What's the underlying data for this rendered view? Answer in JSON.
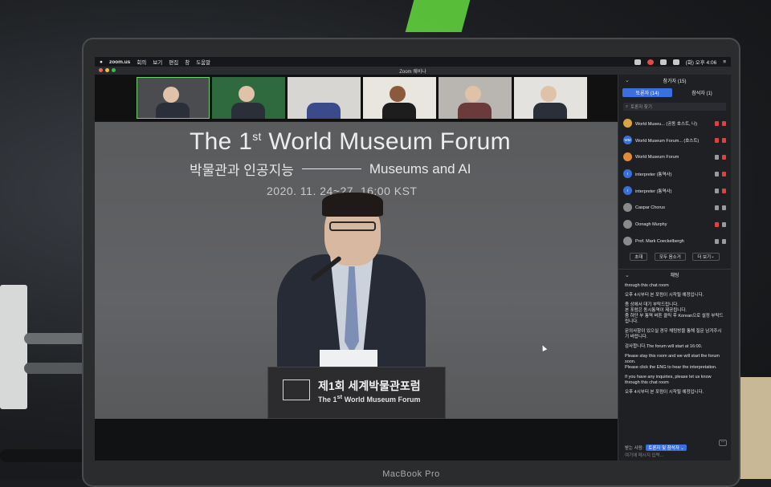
{
  "menubar": {
    "app": "zoom.us",
    "items": [
      "회의",
      "보기",
      "편집",
      "창",
      "도움말"
    ],
    "clock": "(화) 오후 4:06"
  },
  "window": {
    "title": "Zoom 웨비나"
  },
  "main_video": {
    "title": "The 1",
    "title_sup": "st",
    "title_rest": " World Museum Forum",
    "subtitle_kr": "박물관과 인공지능",
    "subtitle_en": "Museums and AI",
    "date": "2020. 11. 24~27. 16:00 KST",
    "podium_kr": "제1회 세계박물관포럼",
    "podium_en_a": "The 1",
    "podium_en_sup": "st",
    "podium_en_b": " World Museum Forum"
  },
  "panel": {
    "title": "참가자 (15)",
    "tab_panelists": "토론자 (14)",
    "tab_attendees": "참석자 (1)",
    "search_placeholder": "토론자 찾기",
    "participants": [
      {
        "name": "World Museu... (공동 호스트, 나)",
        "initials": "",
        "color": "#d9a441"
      },
      {
        "name": "World Museum Forum... (호스트)",
        "initials": "WM",
        "color": "#3a6fd6"
      },
      {
        "name": "World Museum Forum",
        "initials": "",
        "color": "#e08a3a"
      },
      {
        "name": "interpreter (통역사)",
        "initials": "I",
        "color": "#3a6fd6"
      },
      {
        "name": "interpreter (통역사)",
        "initials": "I",
        "color": "#3a6fd6"
      },
      {
        "name": "Caspar Chorus",
        "initials": "",
        "color": "#8a8a8a"
      },
      {
        "name": "Oonagh Murphy",
        "initials": "",
        "color": "#8a8a8a"
      },
      {
        "name": "Prof. Mark Coeckelbergh",
        "initials": "",
        "color": "#8a8a8a"
      }
    ],
    "btn_invite": "초대",
    "btn_mute_all": "모두 음소거",
    "btn_more": "더 보기"
  },
  "chat": {
    "title": "채팅",
    "messages": [
      "through this chat room",
      "오후 4시부터 본 포럼이 시작될 예정입니다.",
      "좀 상에서 대기 부탁드립니다.\n본 포럼은 동시통역이 제공됩니다.\n줌 하단 부 통역 버튼 클릭 후 Korean으로 설정 부탁드립니다.",
      "문의사항이 있으실 경우 채팅방을 통해 질문 남겨주시기 바랍니다.",
      "감사합니다.The forum will start at 16:00.",
      "Please stay this room and we will start the forum soon.\nPlease click the ENG to hear the interpretation.",
      "If you have any inquiries, please let us know through this chat room",
      "오후 4시부터 본 포럼이 시작될 예정입니다."
    ],
    "to_label": "받는 사람:",
    "to_value": "토론자 및 참석자",
    "input_placeholder": "여기에 메시지 입력..."
  },
  "laptop_label": "MacBook Pro"
}
